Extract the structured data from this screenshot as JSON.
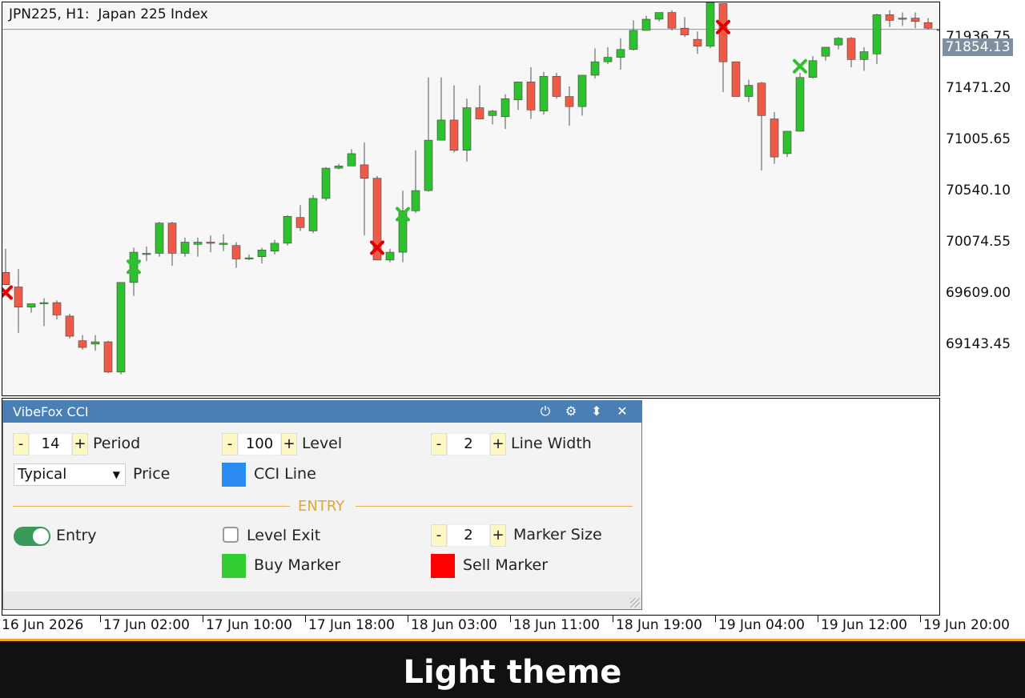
{
  "chart": {
    "title": "JPN225, H1:  Japan 225 Index",
    "current_price": "71854.13",
    "price_ticks": [
      "71936.75",
      "71471.20",
      "71005.65",
      "70540.10",
      "70074.55",
      "69609.00",
      "69143.45"
    ],
    "time_ticks": [
      "16 Jun 2026",
      "17 Jun 02:00",
      "17 Jun 10:00",
      "17 Jun 18:00",
      "18 Jun 03:00",
      "18 Jun 11:00",
      "18 Jun 19:00",
      "19 Jun 04:00",
      "19 Jun 12:00",
      "19 Jun 20:00"
    ],
    "colors": {
      "bull": "#2ec02e",
      "bear": "#f05a46",
      "buy_marker": "#2ec02e",
      "sell_marker": "#e00000"
    }
  },
  "chart_data": {
    "type": "candlestick",
    "symbol": "JPN225",
    "timeframe": "H1",
    "ylim": [
      68620,
      72000
    ],
    "bars": [
      {
        "o": 69690,
        "h": 69900,
        "l": 69580,
        "c": 69580
      },
      {
        "o": 69560,
        "h": 69720,
        "l": 69150,
        "c": 69380
      },
      {
        "o": 69380,
        "h": 69410,
        "l": 69330,
        "c": 69410
      },
      {
        "o": 69420,
        "h": 69460,
        "l": 69210,
        "c": 69420
      },
      {
        "o": 69420,
        "h": 69440,
        "l": 69270,
        "c": 69310
      },
      {
        "o": 69300,
        "h": 69320,
        "l": 69100,
        "c": 69120
      },
      {
        "o": 69080,
        "h": 69130,
        "l": 69000,
        "c": 69020
      },
      {
        "o": 69050,
        "h": 69130,
        "l": 68990,
        "c": 69070
      },
      {
        "o": 69070,
        "h": 69080,
        "l": 68790,
        "c": 68800
      },
      {
        "o": 68800,
        "h": 69600,
        "l": 68780,
        "c": 69600
      },
      {
        "o": 69600,
        "h": 69910,
        "l": 69480,
        "c": 69870
      },
      {
        "o": 69860,
        "h": 69920,
        "l": 69790,
        "c": 69860
      },
      {
        "o": 69860,
        "h": 70140,
        "l": 69830,
        "c": 70130
      },
      {
        "o": 70130,
        "h": 70140,
        "l": 69750,
        "c": 69860
      },
      {
        "o": 69860,
        "h": 70000,
        "l": 69830,
        "c": 69960
      },
      {
        "o": 69940,
        "h": 70000,
        "l": 69830,
        "c": 69960
      },
      {
        "o": 69960,
        "h": 70020,
        "l": 69870,
        "c": 69950
      },
      {
        "o": 69950,
        "h": 70030,
        "l": 69880,
        "c": 69950
      },
      {
        "o": 69930,
        "h": 69960,
        "l": 69730,
        "c": 69810
      },
      {
        "o": 69820,
        "h": 69850,
        "l": 69800,
        "c": 69820
      },
      {
        "o": 69830,
        "h": 69910,
        "l": 69770,
        "c": 69890
      },
      {
        "o": 69880,
        "h": 69980,
        "l": 69850,
        "c": 69950
      },
      {
        "o": 69950,
        "h": 70200,
        "l": 69930,
        "c": 70190
      },
      {
        "o": 70180,
        "h": 70290,
        "l": 70060,
        "c": 70090
      },
      {
        "o": 70060,
        "h": 70380,
        "l": 70040,
        "c": 70350
      },
      {
        "o": 70350,
        "h": 70630,
        "l": 70330,
        "c": 70620
      },
      {
        "o": 70620,
        "h": 70660,
        "l": 70610,
        "c": 70640
      },
      {
        "o": 70640,
        "h": 70790,
        "l": 70640,
        "c": 70750
      },
      {
        "o": 70650,
        "h": 70850,
        "l": 70020,
        "c": 70530
      },
      {
        "o": 70530,
        "h": 70550,
        "l": 69800,
        "c": 69800
      },
      {
        "o": 69800,
        "h": 69900,
        "l": 69780,
        "c": 69870
      },
      {
        "o": 69870,
        "h": 70420,
        "l": 69780,
        "c": 70240
      },
      {
        "o": 70240,
        "h": 70780,
        "l": 70220,
        "c": 70420
      },
      {
        "o": 70420,
        "h": 71430,
        "l": 70410,
        "c": 70870
      },
      {
        "o": 70870,
        "h": 71430,
        "l": 70870,
        "c": 71050
      },
      {
        "o": 71050,
        "h": 71360,
        "l": 70760,
        "c": 70780
      },
      {
        "o": 70780,
        "h": 71240,
        "l": 70680,
        "c": 71160
      },
      {
        "o": 71160,
        "h": 71360,
        "l": 71060,
        "c": 71060
      },
      {
        "o": 71090,
        "h": 71140,
        "l": 71010,
        "c": 71130
      },
      {
        "o": 71080,
        "h": 71280,
        "l": 70970,
        "c": 71240
      },
      {
        "o": 71230,
        "h": 71390,
        "l": 71140,
        "c": 71390
      },
      {
        "o": 71390,
        "h": 71520,
        "l": 71060,
        "c": 71140
      },
      {
        "o": 71130,
        "h": 71480,
        "l": 71100,
        "c": 71440
      },
      {
        "o": 71440,
        "h": 71470,
        "l": 71240,
        "c": 71260
      },
      {
        "o": 71260,
        "h": 71350,
        "l": 71000,
        "c": 71170
      },
      {
        "o": 71170,
        "h": 71450,
        "l": 71090,
        "c": 71450
      },
      {
        "o": 71450,
        "h": 71690,
        "l": 71420,
        "c": 71570
      },
      {
        "o": 71570,
        "h": 71700,
        "l": 71550,
        "c": 71610
      },
      {
        "o": 71610,
        "h": 71780,
        "l": 71500,
        "c": 71680
      },
      {
        "o": 71680,
        "h": 71940,
        "l": 71670,
        "c": 71850
      },
      {
        "o": 71850,
        "h": 71980,
        "l": 71860,
        "c": 71950
      },
      {
        "o": 71950,
        "h": 72000,
        "l": 71930,
        "c": 72010
      },
      {
        "o": 72010,
        "h": 72030,
        "l": 71850,
        "c": 71870
      },
      {
        "o": 71870,
        "h": 71970,
        "l": 71790,
        "c": 71810
      },
      {
        "o": 71770,
        "h": 71840,
        "l": 71640,
        "c": 71710
      },
      {
        "o": 71710,
        "h": 72150,
        "l": 71690,
        "c": 72100
      },
      {
        "o": 72090,
        "h": 72090,
        "l": 71300,
        "c": 71570
      },
      {
        "o": 71570,
        "h": 71570,
        "l": 71270,
        "c": 71260
      },
      {
        "o": 71260,
        "h": 71410,
        "l": 71210,
        "c": 71360
      },
      {
        "o": 71380,
        "h": 71390,
        "l": 70600,
        "c": 71090
      },
      {
        "o": 71060,
        "h": 71120,
        "l": 70660,
        "c": 70720
      },
      {
        "o": 70750,
        "h": 70950,
        "l": 70720,
        "c": 70950
      },
      {
        "o": 70950,
        "h": 71470,
        "l": 70950,
        "c": 71430
      },
      {
        "o": 71430,
        "h": 71620,
        "l": 71420,
        "c": 71580
      },
      {
        "o": 71620,
        "h": 71700,
        "l": 71580,
        "c": 71700
      },
      {
        "o": 71720,
        "h": 71790,
        "l": 71680,
        "c": 71780
      },
      {
        "o": 71780,
        "h": 71790,
        "l": 71520,
        "c": 71590
      },
      {
        "o": 71590,
        "h": 71700,
        "l": 71490,
        "c": 71660
      },
      {
        "o": 71640,
        "h": 72000,
        "l": 71550,
        "c": 71990
      },
      {
        "o": 71990,
        "h": 72030,
        "l": 71880,
        "c": 71940
      },
      {
        "o": 71950,
        "h": 72010,
        "l": 71890,
        "c": 71960
      },
      {
        "o": 71960,
        "h": 72010,
        "l": 71870,
        "c": 71930
      },
      {
        "o": 71920,
        "h": 71960,
        "l": 71860,
        "c": 71870
      },
      {
        "o": 71860,
        "h": 71870,
        "l": 71850,
        "c": 71860
      }
    ],
    "buy_markers": [
      {
        "bar": 10,
        "price": 69740
      },
      {
        "bar": 31,
        "price": 70210
      },
      {
        "bar": 62,
        "price": 71530
      }
    ],
    "sell_markers": [
      {
        "bar": 0,
        "price": 69510
      },
      {
        "bar": 29,
        "price": 69910
      },
      {
        "bar": 56,
        "price": 71880
      }
    ]
  },
  "panel": {
    "title": "VibeFox CCI",
    "icons": [
      "power-icon",
      "gear-icon",
      "move-icon",
      "close-icon"
    ],
    "minus": "-",
    "plus": "+",
    "period": {
      "value": "14",
      "label": "Period"
    },
    "level": {
      "value": "100",
      "label": "Level"
    },
    "line_width": {
      "value": "2",
      "label": "Line Width"
    },
    "price": {
      "value": "Typical",
      "label": "Price"
    },
    "cci_line": {
      "label": "CCI Line",
      "color": "#2a8bf2"
    },
    "entry_section": "ENTRY",
    "entry": {
      "label": "Entry",
      "enabled": true
    },
    "level_exit": {
      "label": "Level Exit",
      "checked": false
    },
    "marker_size": {
      "value": "2",
      "label": "Marker Size"
    },
    "buy_marker": {
      "label": "Buy Marker",
      "color": "#32cd32"
    },
    "sell_marker": {
      "label": "Sell Marker",
      "color": "#ff0000"
    }
  },
  "banner": {
    "text": "Light theme"
  }
}
